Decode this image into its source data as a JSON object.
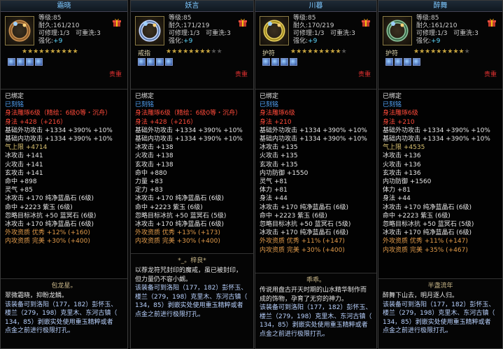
{
  "items": [
    {
      "name": "霜晓",
      "level": "等级:85",
      "durability": "耐久:161/210",
      "refine": "可修理:1/3",
      "rewash": "可重洗:3",
      "enhance_label": "强化:",
      "enhance": "+9",
      "type": "",
      "stars": "★★★★★★★★★★",
      "stars_dim": "",
      "tag": "贵重",
      "lines": [
        {
          "t": "已绑定",
          "c": "w"
        },
        {
          "t": "已刻铭",
          "c": "b"
        },
        {
          "t": "身法雕琢6级（精绘：6级0等・沉舟）",
          "c": "r"
        },
        {
          "t": "身法 +428（+216）",
          "c": "r"
        },
        {
          "t": "基础外功攻击 +1334 +390% +10%",
          "c": "w"
        },
        {
          "t": "基础内功攻击 +1334 +390% +10%",
          "c": "w"
        },
        {
          "t": "气上限 +4714",
          "c": "y"
        },
        {
          "t": "冰攻击 +141",
          "c": "w"
        },
        {
          "t": "火攻击 +141",
          "c": "w"
        },
        {
          "t": "玄攻击 +141",
          "c": "w"
        },
        {
          "t": "命中 +898",
          "c": "w"
        },
        {
          "t": "灵气 +85",
          "c": "w"
        },
        {
          "t": "冰攻击 +170 纯净蓝晶石 (6级)",
          "c": "w"
        },
        {
          "t": "命中 +2223 紫玉 (6级)",
          "c": "w"
        },
        {
          "t": "忽略目标冰抗 +50 蓝冥石 (6级)",
          "c": "w"
        },
        {
          "t": "冰攻击 +170 纯净蓝晶石 (6级)",
          "c": "w"
        },
        {
          "t": "外攻资质  优秀 +12% (+160)",
          "c": "o"
        },
        {
          "t": "内攻资质  完美 +30% (+400)",
          "c": "o"
        }
      ],
      "set_name": "包龙星。",
      "desc_lines": [
        {
          "t": "翠微霜晓，抑盼龙鳞。",
          "c": "w"
        },
        {
          "t": "该装备可到洛阳（177，182）彭怀玉、",
          "c": "t"
        },
        {
          "t": "楼兰（279，198）克里木、东河古镇（",
          "c": "t"
        },
        {
          "t": "134，85）剥嵌实处使用重玉精粹或者",
          "c": "t"
        },
        {
          "t": "点金之前进行极限打孔。",
          "c": "t"
        }
      ]
    },
    {
      "name": "妖言",
      "level": "等级:85",
      "durability": "耐久:171/219",
      "refine": "可修理:1/3",
      "rewash": "可重洗:3",
      "enhance_label": "强化:",
      "enhance": "+9",
      "type": "戒指",
      "stars": "★★★★★★★★",
      "stars_dim": "★★",
      "tag": "贵重",
      "lines": [
        {
          "t": "已绑定",
          "c": "w"
        },
        {
          "t": "已刻铭",
          "c": "b"
        },
        {
          "t": "身法雕琢6级（精绘：6级0等・沉舟）",
          "c": "r"
        },
        {
          "t": "身法 +428（+216）",
          "c": "r"
        },
        {
          "t": "基础外功攻击 +1334 +390% +10%",
          "c": "w"
        },
        {
          "t": "基础内功攻击 +1334 +390% +10%",
          "c": "w"
        },
        {
          "t": "冰攻击 +138",
          "c": "w"
        },
        {
          "t": "火攻击 +138",
          "c": "w"
        },
        {
          "t": "玄攻击 +138",
          "c": "w"
        },
        {
          "t": "命中 +880",
          "c": "w"
        },
        {
          "t": "力量 +83",
          "c": "w"
        },
        {
          "t": "定力 +83",
          "c": "w"
        },
        {
          "t": "冰攻击 +170 纯净蓝晶石 (6级)",
          "c": "w"
        },
        {
          "t": "命中 +2223 紫玉 (6级)",
          "c": "w"
        },
        {
          "t": "忽略目标冰抗 +50 蓝冥石 (5级)",
          "c": "w"
        },
        {
          "t": "冰攻击 +170 纯净蓝晶石 (6级)",
          "c": "w"
        },
        {
          "t": "外攻资质  优秀 +13% (+173)",
          "c": "o"
        },
        {
          "t": "内攻资质  完美 +30% (+400)",
          "c": "o"
        }
      ],
      "set_name": "*_。梓良*",
      "desc_lines": [
        {
          "t": "以荐龙符咒封印的魔戒，虽已被封印，",
          "c": "w"
        },
        {
          "t": "但力量仍不容小觑。",
          "c": "w"
        },
        {
          "t": "该装备可到洛阳（177，182）彭怀玉、",
          "c": "t"
        },
        {
          "t": "楼兰（279，198）克里木、东河古镇（",
          "c": "t"
        },
        {
          "t": "134，85）剥嵌实处使用重玉精粹或者",
          "c": "t"
        },
        {
          "t": "点金之前进行极限打孔。",
          "c": "t"
        }
      ]
    },
    {
      "name": "川暮",
      "level": "等级:85",
      "durability": "耐久:170/219",
      "refine": "可修理:1/3",
      "rewash": "可重洗:3",
      "enhance_label": "强化:",
      "enhance": "+9",
      "type": "护符",
      "stars": "★★★★★★★★★",
      "stars_dim": "★",
      "tag": "贵重",
      "lines": [
        {
          "t": "已绑定",
          "c": "w"
        },
        {
          "t": "已刻铭",
          "c": "b"
        },
        {
          "t": "身法雕琢6级",
          "c": "r"
        },
        {
          "t": "身法 +210",
          "c": "r"
        },
        {
          "t": "基础外功攻击 +1334 +390% +10%",
          "c": "w"
        },
        {
          "t": "基础内功攻击 +1334 +390% +10%",
          "c": "w"
        },
        {
          "t": "冰攻击 +135",
          "c": "w"
        },
        {
          "t": "火攻击 +135",
          "c": "w"
        },
        {
          "t": "玄攻击 +135",
          "c": "w"
        },
        {
          "t": "内功防御 +1550",
          "c": "w"
        },
        {
          "t": "灵气 +81",
          "c": "w"
        },
        {
          "t": "体力 +81",
          "c": "w"
        },
        {
          "t": "身法 +44",
          "c": "w"
        },
        {
          "t": "冰攻击 +170 纯净蓝晶石 (6级)",
          "c": "w"
        },
        {
          "t": "命中 +2223 紫玉 (6级)",
          "c": "w"
        },
        {
          "t": "忽略目标冰抗 +50 蓝冥石 (5级)",
          "c": "w"
        },
        {
          "t": "冰攻击 +170 纯净蓝晶石 (6级)",
          "c": "w"
        },
        {
          "t": "外攻资质  优秀 +11% (+147)",
          "c": "o"
        },
        {
          "t": "内攻资质  完美 +30% (+400)",
          "c": "o"
        }
      ],
      "set_name": "乖乖。",
      "desc_lines": [
        {
          "t": "传说用盘古开天时期的山水精华制作而",
          "c": "w"
        },
        {
          "t": "成的饰物，孕育了无穷的神力。",
          "c": "w"
        },
        {
          "t": "该装备可到洛阳（177，182）彭怀玉、",
          "c": "t"
        },
        {
          "t": "楼兰（279，198）克里木、东河古镇（",
          "c": "t"
        },
        {
          "t": "134，85）剥嵌实处使用重玉精粹或者",
          "c": "t"
        },
        {
          "t": "点金之前进行极限打孔。",
          "c": "t"
        }
      ]
    },
    {
      "name": "醉舞",
      "level": "等级:85",
      "durability": "耐久:161/210",
      "refine": "可修理:1/3",
      "rewash": "可重洗:3",
      "enhance_label": "强化:",
      "enhance": "+9",
      "type": "护符",
      "stars": "★★★★★★★★★",
      "stars_dim": "★",
      "tag": "贵重",
      "lines": [
        {
          "t": "已绑定",
          "c": "w"
        },
        {
          "t": "已刻铭",
          "c": "b"
        },
        {
          "t": "身法雕琢6级",
          "c": "r"
        },
        {
          "t": "身法 +210",
          "c": "r"
        },
        {
          "t": "基础外功攻击 +1334 +390% +10%",
          "c": "w"
        },
        {
          "t": "基础内功攻击 +1334 +390% +10%",
          "c": "w"
        },
        {
          "t": "气上限 +4535",
          "c": "y"
        },
        {
          "t": "冰攻击 +136",
          "c": "w"
        },
        {
          "t": "火攻击 +136",
          "c": "w"
        },
        {
          "t": "玄攻击 +136",
          "c": "w"
        },
        {
          "t": "内功防御 +1560",
          "c": "w"
        },
        {
          "t": "体力 +81",
          "c": "w"
        },
        {
          "t": "身法 +44",
          "c": "w"
        },
        {
          "t": "冰攻击 +170 纯净蓝晶石 (6级)",
          "c": "w"
        },
        {
          "t": "命中 +2223 紫玉 (6级)",
          "c": "w"
        },
        {
          "t": "忽略目标冰抗 +50 蓝冥石 (5级)",
          "c": "w"
        },
        {
          "t": "冰攻击 +170 纯净蓝晶石 (6级)",
          "c": "w"
        },
        {
          "t": "外攻资质  优秀 +11% (+147)",
          "c": "o"
        },
        {
          "t": "内攻资质  完美 +35% (+467)",
          "c": "o"
        }
      ],
      "set_name": "半盏流年",
      "desc_lines": [
        {
          "t": "醉舞下山去，明月逐人归。",
          "c": "w"
        },
        {
          "t": "该装备可到洛阳（177，182）彭怀玉、",
          "c": "t"
        },
        {
          "t": "楼兰（279，198）克里木、东河古镇（",
          "c": "t"
        },
        {
          "t": "134，85）剥嵌实处使用重玉精粹或者",
          "c": "t"
        },
        {
          "t": "点金之前进行极限打孔。",
          "c": "t"
        }
      ]
    }
  ]
}
